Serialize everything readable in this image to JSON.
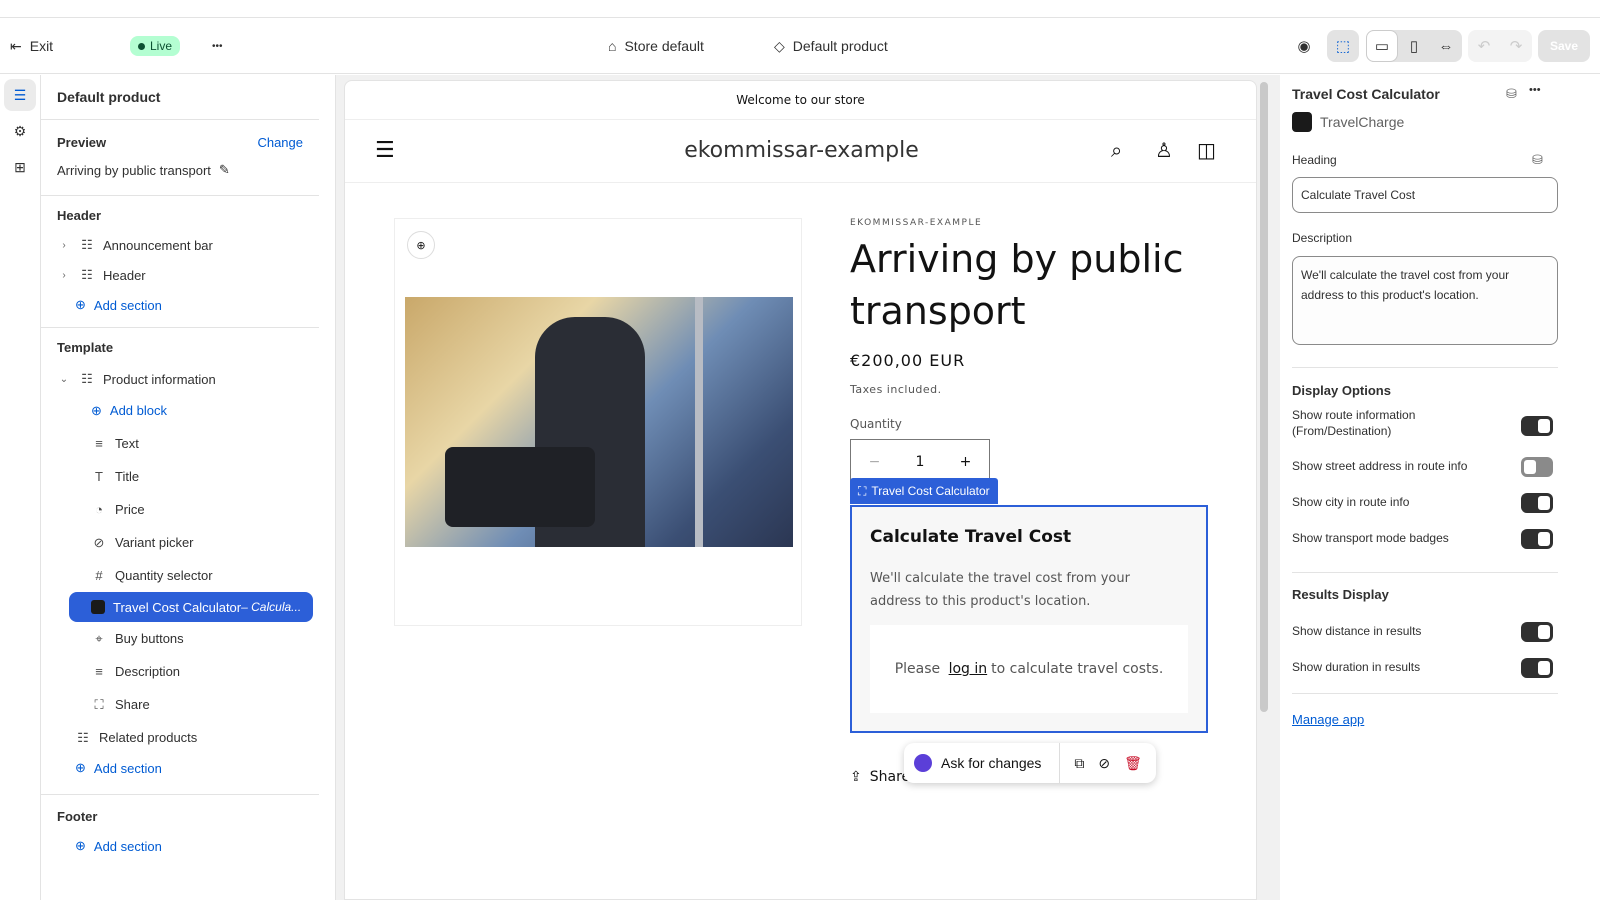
{
  "topbar": {
    "exit": "Exit",
    "live": "Live",
    "more": "•••",
    "store": "Store default",
    "template": "Default product",
    "save": "Save"
  },
  "left": {
    "title": "Default product",
    "preview_label": "Preview",
    "change": "Change",
    "preview_value": "Arriving by public transport",
    "header_group": "Header",
    "header_items": [
      "Announcement bar",
      "Header"
    ],
    "add_section": "Add section",
    "template_group": "Template",
    "product_info": "Product information",
    "add_block": "Add block",
    "blocks": [
      "Text",
      "Title",
      "Price",
      "Variant picker",
      "Quantity selector"
    ],
    "selected_block": "Travel Cost Calculator",
    "selected_sub": " – Calcula...",
    "blocks_after": [
      "Buy buttons",
      "Description",
      "Share"
    ],
    "related": "Related products",
    "footer_group": "Footer"
  },
  "store": {
    "announcement": "Welcome to our store",
    "name": "ekommissar-example",
    "vendor": "EKOMMISSAR-EXAMPLE",
    "product_title": "Arriving by public transport",
    "price": "€200,00 EUR",
    "taxes": "Taxes included.",
    "quantity_label": "Quantity",
    "quantity": "1",
    "block_tag": "Travel Cost Calculator",
    "calc_heading": "Calculate Travel Cost",
    "calc_desc": "We'll calculate the travel cost from your address to this product's location.",
    "login_pre": "Please ",
    "login_link": "log in",
    "login_post": " to calculate travel costs.",
    "share": "Share",
    "ask": "Ask for changes"
  },
  "right": {
    "title": "Travel Cost Calculator",
    "app": "TravelCharge",
    "heading_label": "Heading",
    "heading_value": "Calculate Travel Cost",
    "desc_label": "Description",
    "desc_value": "We'll calculate the travel cost from your address to this product's location.",
    "display_options": "Display Options",
    "options": [
      {
        "label": "Show route information (From/Destination)",
        "on": true
      },
      {
        "label": "Show street address in route info",
        "on": false
      },
      {
        "label": "Show city in route info",
        "on": true
      },
      {
        "label": "Show transport mode badges",
        "on": true
      }
    ],
    "results_display": "Results Display",
    "results": [
      {
        "label": "Show distance in results",
        "on": true
      },
      {
        "label": "Show duration in results",
        "on": true
      }
    ],
    "manage": "Manage app"
  }
}
